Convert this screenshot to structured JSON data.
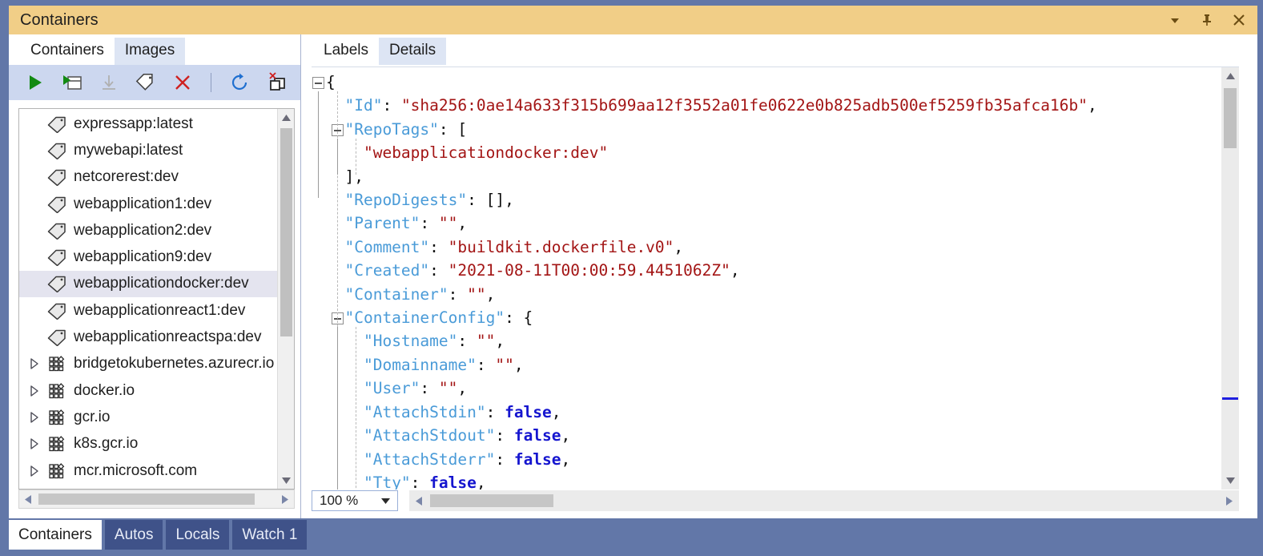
{
  "window": {
    "title": "Containers",
    "controls": [
      {
        "name": "dropdown-icon",
        "label": "Window options"
      },
      {
        "name": "pin-icon",
        "label": "Auto Hide"
      },
      {
        "name": "close-icon",
        "label": "Close"
      }
    ]
  },
  "left_panel": {
    "tabs": [
      {
        "label": "Containers",
        "active": false
      },
      {
        "label": "Images",
        "active": true
      }
    ],
    "toolbar": [
      {
        "name": "run-icon",
        "label": "Run",
        "enabled": true
      },
      {
        "name": "open-in-window-icon",
        "label": "Open in Window",
        "enabled": true
      },
      {
        "name": "pull-icon",
        "label": "Pull",
        "enabled": false
      },
      {
        "name": "tag-icon",
        "label": "Tag",
        "enabled": true
      },
      {
        "name": "delete-icon",
        "label": "Remove",
        "enabled": true
      },
      {
        "name": "refresh-icon",
        "label": "Refresh",
        "enabled": true
      },
      {
        "name": "prune-icon",
        "label": "Prune",
        "enabled": true
      }
    ],
    "tree_items": [
      {
        "label": "expressapp:latest",
        "icon": "tag-icon",
        "expandable": false,
        "selected": false
      },
      {
        "label": "mywebapi:latest",
        "icon": "tag-icon",
        "expandable": false,
        "selected": false
      },
      {
        "label": "netcorerest:dev",
        "icon": "tag-icon",
        "expandable": false,
        "selected": false
      },
      {
        "label": "webapplication1:dev",
        "icon": "tag-icon",
        "expandable": false,
        "selected": false
      },
      {
        "label": "webapplication2:dev",
        "icon": "tag-icon",
        "expandable": false,
        "selected": false
      },
      {
        "label": "webapplication9:dev",
        "icon": "tag-icon",
        "expandable": false,
        "selected": false
      },
      {
        "label": "webapplicationdocker:dev",
        "icon": "tag-icon",
        "expandable": false,
        "selected": true
      },
      {
        "label": "webapplicationreact1:dev",
        "icon": "tag-icon",
        "expandable": false,
        "selected": false
      },
      {
        "label": "webapplicationreactspa:dev",
        "icon": "tag-icon",
        "expandable": false,
        "selected": false
      },
      {
        "label": "bridgetokubernetes.azurecr.io",
        "icon": "registry-icon",
        "expandable": true,
        "selected": false
      },
      {
        "label": "docker.io",
        "icon": "registry-icon",
        "expandable": true,
        "selected": false
      },
      {
        "label": "gcr.io",
        "icon": "registry-icon",
        "expandable": true,
        "selected": false
      },
      {
        "label": "k8s.gcr.io",
        "icon": "registry-icon",
        "expandable": true,
        "selected": false
      },
      {
        "label": "mcr.microsoft.com",
        "icon": "registry-icon",
        "expandable": true,
        "selected": false
      }
    ]
  },
  "right_panel": {
    "tabs": [
      {
        "label": "Labels",
        "active": false
      },
      {
        "label": "Details",
        "active": true
      }
    ],
    "zoom_level": "100 %",
    "json_lines": [
      {
        "indent": 0,
        "collapse": true,
        "tokens": [
          {
            "t": "{",
            "c": "jp"
          }
        ]
      },
      {
        "indent": 1,
        "tokens": [
          {
            "t": "\"Id\"",
            "c": "jk"
          },
          {
            "t": ": ",
            "c": "jp"
          },
          {
            "t": "\"sha256:0ae14a633f315b699aa12f3552a01fe0622e0b825adb500ef5259fb35afca16b\"",
            "c": "js"
          },
          {
            "t": ",",
            "c": "jp"
          }
        ]
      },
      {
        "indent": 1,
        "collapse": true,
        "tokens": [
          {
            "t": "\"RepoTags\"",
            "c": "jk"
          },
          {
            "t": ": [",
            "c": "jp"
          }
        ]
      },
      {
        "indent": 2,
        "tokens": [
          {
            "t": "\"webapplicationdocker:dev\"",
            "c": "js"
          }
        ]
      },
      {
        "indent": 1,
        "tokens": [
          {
            "t": "],",
            "c": "jp"
          }
        ]
      },
      {
        "indent": 1,
        "tokens": [
          {
            "t": "\"RepoDigests\"",
            "c": "jk"
          },
          {
            "t": ": [],",
            "c": "jp"
          }
        ]
      },
      {
        "indent": 1,
        "tokens": [
          {
            "t": "\"Parent\"",
            "c": "jk"
          },
          {
            "t": ": ",
            "c": "jp"
          },
          {
            "t": "\"\"",
            "c": "js"
          },
          {
            "t": ",",
            "c": "jp"
          }
        ]
      },
      {
        "indent": 1,
        "tokens": [
          {
            "t": "\"Comment\"",
            "c": "jk"
          },
          {
            "t": ": ",
            "c": "jp"
          },
          {
            "t": "\"buildkit.dockerfile.v0\"",
            "c": "js"
          },
          {
            "t": ",",
            "c": "jp"
          }
        ]
      },
      {
        "indent": 1,
        "tokens": [
          {
            "t": "\"Created\"",
            "c": "jk"
          },
          {
            "t": ": ",
            "c": "jp"
          },
          {
            "t": "\"2021-08-11T00:00:59.4451062Z\"",
            "c": "js"
          },
          {
            "t": ",",
            "c": "jp"
          }
        ]
      },
      {
        "indent": 1,
        "tokens": [
          {
            "t": "\"Container\"",
            "c": "jk"
          },
          {
            "t": ": ",
            "c": "jp"
          },
          {
            "t": "\"\"",
            "c": "js"
          },
          {
            "t": ",",
            "c": "jp"
          }
        ]
      },
      {
        "indent": 1,
        "collapse": true,
        "tokens": [
          {
            "t": "\"ContainerConfig\"",
            "c": "jk"
          },
          {
            "t": ": {",
            "c": "jp"
          }
        ]
      },
      {
        "indent": 2,
        "tokens": [
          {
            "t": "\"Hostname\"",
            "c": "jk"
          },
          {
            "t": ": ",
            "c": "jp"
          },
          {
            "t": "\"\"",
            "c": "js"
          },
          {
            "t": ",",
            "c": "jp"
          }
        ]
      },
      {
        "indent": 2,
        "tokens": [
          {
            "t": "\"Domainname\"",
            "c": "jk"
          },
          {
            "t": ": ",
            "c": "jp"
          },
          {
            "t": "\"\"",
            "c": "js"
          },
          {
            "t": ",",
            "c": "jp"
          }
        ]
      },
      {
        "indent": 2,
        "tokens": [
          {
            "t": "\"User\"",
            "c": "jk"
          },
          {
            "t": ": ",
            "c": "jp"
          },
          {
            "t": "\"\"",
            "c": "js"
          },
          {
            "t": ",",
            "c": "jp"
          }
        ]
      },
      {
        "indent": 2,
        "tokens": [
          {
            "t": "\"AttachStdin\"",
            "c": "jk"
          },
          {
            "t": ": ",
            "c": "jp"
          },
          {
            "t": "false",
            "c": "jb"
          },
          {
            "t": ",",
            "c": "jp"
          }
        ]
      },
      {
        "indent": 2,
        "tokens": [
          {
            "t": "\"AttachStdout\"",
            "c": "jk"
          },
          {
            "t": ": ",
            "c": "jp"
          },
          {
            "t": "false",
            "c": "jb"
          },
          {
            "t": ",",
            "c": "jp"
          }
        ]
      },
      {
        "indent": 2,
        "tokens": [
          {
            "t": "\"AttachStderr\"",
            "c": "jk"
          },
          {
            "t": ": ",
            "c": "jp"
          },
          {
            "t": "false",
            "c": "jb"
          },
          {
            "t": ",",
            "c": "jp"
          }
        ]
      },
      {
        "indent": 2,
        "tokens": [
          {
            "t": "\"Tty\"",
            "c": "jk"
          },
          {
            "t": ": ",
            "c": "jp"
          },
          {
            "t": "false",
            "c": "jb"
          },
          {
            "t": ",",
            "c": "jp"
          }
        ]
      }
    ]
  },
  "bottom_tabs": [
    {
      "label": "Containers",
      "active": true
    },
    {
      "label": "Autos",
      "active": false
    },
    {
      "label": "Locals",
      "active": false
    },
    {
      "label": "Watch 1",
      "active": false
    }
  ],
  "colors": {
    "titlebar": "#f1ce87",
    "window_chrome": "#6277a8",
    "toolbar": "#ccd7ef",
    "active_tab": "#dde5f4",
    "selection": "#e4e4ef",
    "json_key": "#4a9bd8",
    "json_string": "#a31515",
    "json_bool": "#1515cf"
  }
}
